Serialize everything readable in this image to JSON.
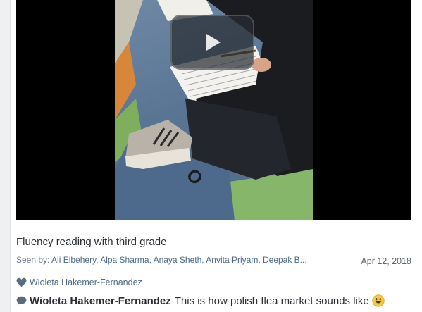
{
  "post": {
    "caption": "Fluency reading with third grade",
    "seen_by_label": "Seen by:",
    "seen_by_names": "Ali Elbehery, Alpa Sharma, Anaya Sheth, Anvita Priyam, Deepak B...",
    "date": "Apr 12, 2018",
    "video": {
      "play_icon": "play-icon"
    }
  },
  "likes": {
    "icon": "heart-icon",
    "liked_by": "Wioleta Hakemer-Fernandez"
  },
  "comments": [
    {
      "icon": "comment-bubble-icon",
      "author": "Wioleta Hakemer-Fernandez",
      "text": "This is how polish flea market sounds like",
      "emoji": "smiley-emoji"
    }
  ],
  "colors": {
    "link": "#4f6b8a",
    "text": "#2b2f33",
    "heart": "#5a6b7d"
  }
}
